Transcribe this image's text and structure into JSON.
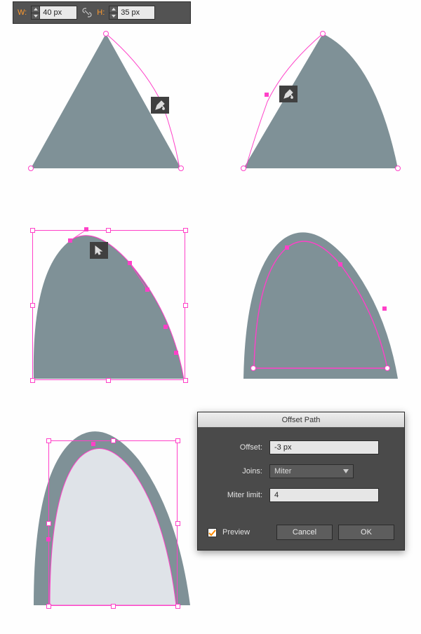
{
  "transform_panel": {
    "w_label": "W:",
    "w_value": "40 px",
    "h_label": "H:",
    "h_value": "35 px"
  },
  "tools": {
    "pen_add": "pen-add-anchor",
    "direct_select": "direct-selection"
  },
  "dialog": {
    "title": "Offset Path",
    "offset_lbl": "Offset:",
    "offset_val": "-3 px",
    "joins_lbl": "Joins:",
    "joins_val": "Miter",
    "miter_lbl": "Miter limit:",
    "miter_val": "4",
    "preview": "Preview",
    "cancel": "Cancel",
    "ok": "OK"
  },
  "colors": {
    "shape_fill": "#7f9197",
    "shape_light": "#dfe3e8",
    "path_pink": "#ff40c8",
    "sel_blue": "#0cc3e8"
  }
}
